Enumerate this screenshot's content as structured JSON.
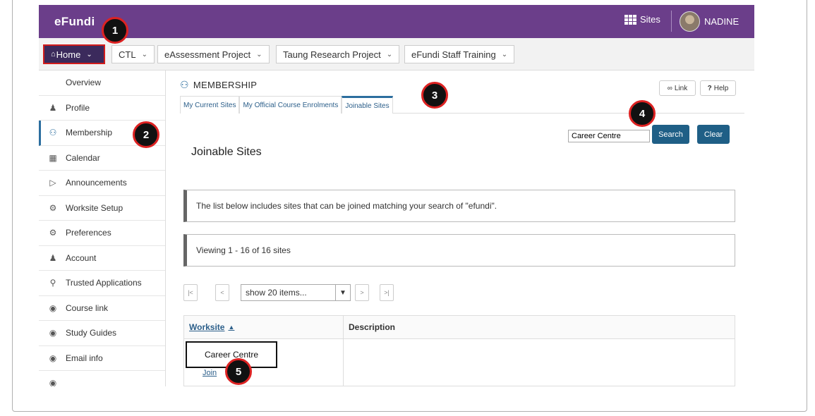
{
  "header": {
    "logo": "eFundi",
    "sites_label": "Sites",
    "user_name": "NADINE"
  },
  "nav_tabs": [
    {
      "label": "Home"
    },
    {
      "label": "CTL"
    },
    {
      "label": "eAssessment Project"
    },
    {
      "label": "Taung Research Project"
    },
    {
      "label": "eFundi Staff Training"
    }
  ],
  "sidebar": {
    "items": [
      {
        "label": "Overview",
        "icon": "none"
      },
      {
        "label": "Profile",
        "icon": "person-icon"
      },
      {
        "label": "Membership",
        "icon": "users-icon"
      },
      {
        "label": "Calendar",
        "icon": "calendar-icon"
      },
      {
        "label": "Announcements",
        "icon": "megaphone-icon"
      },
      {
        "label": "Worksite Setup",
        "icon": "gears-icon"
      },
      {
        "label": "Preferences",
        "icon": "gear-icon"
      },
      {
        "label": "Account",
        "icon": "person-icon"
      },
      {
        "label": "Trusted Applications",
        "icon": "key-icon"
      },
      {
        "label": "Course link",
        "icon": "globe-icon"
      },
      {
        "label": "Study Guides",
        "icon": "globe-icon"
      },
      {
        "label": "Email info",
        "icon": "globe-icon"
      }
    ]
  },
  "tool": {
    "title": "MEMBERSHIP",
    "link_label": "Link",
    "help_label": "Help",
    "tabs": [
      {
        "label": "My Current Sites"
      },
      {
        "label": "My Official Course Enrolments"
      },
      {
        "label": "Joinable Sites"
      }
    ]
  },
  "search": {
    "value": "Career Centre",
    "search_label": "Search",
    "clear_label": "Clear"
  },
  "page_title": "Joinable Sites",
  "info_message": "The list below includes sites that can be joined matching your search of \"efundi\".",
  "viewing_message": "Viewing 1 - 16 of 16 sites",
  "pager": {
    "first": "|<",
    "prev": "<",
    "page_size": "show 20 items...",
    "next": ">",
    "last": ">|"
  },
  "table": {
    "columns": [
      "Worksite",
      "Description"
    ],
    "rows": [
      {
        "worksite": "Career Centre",
        "action": "Join",
        "description": ""
      }
    ]
  },
  "callouts": [
    "1",
    "2",
    "3",
    "4",
    "5"
  ],
  "colors": {
    "header_bg": "#6b3e8a",
    "home_tab_bg": "#3b2a5c",
    "accent_blue": "#1f5f86",
    "callout_ring": "#dd2222"
  }
}
